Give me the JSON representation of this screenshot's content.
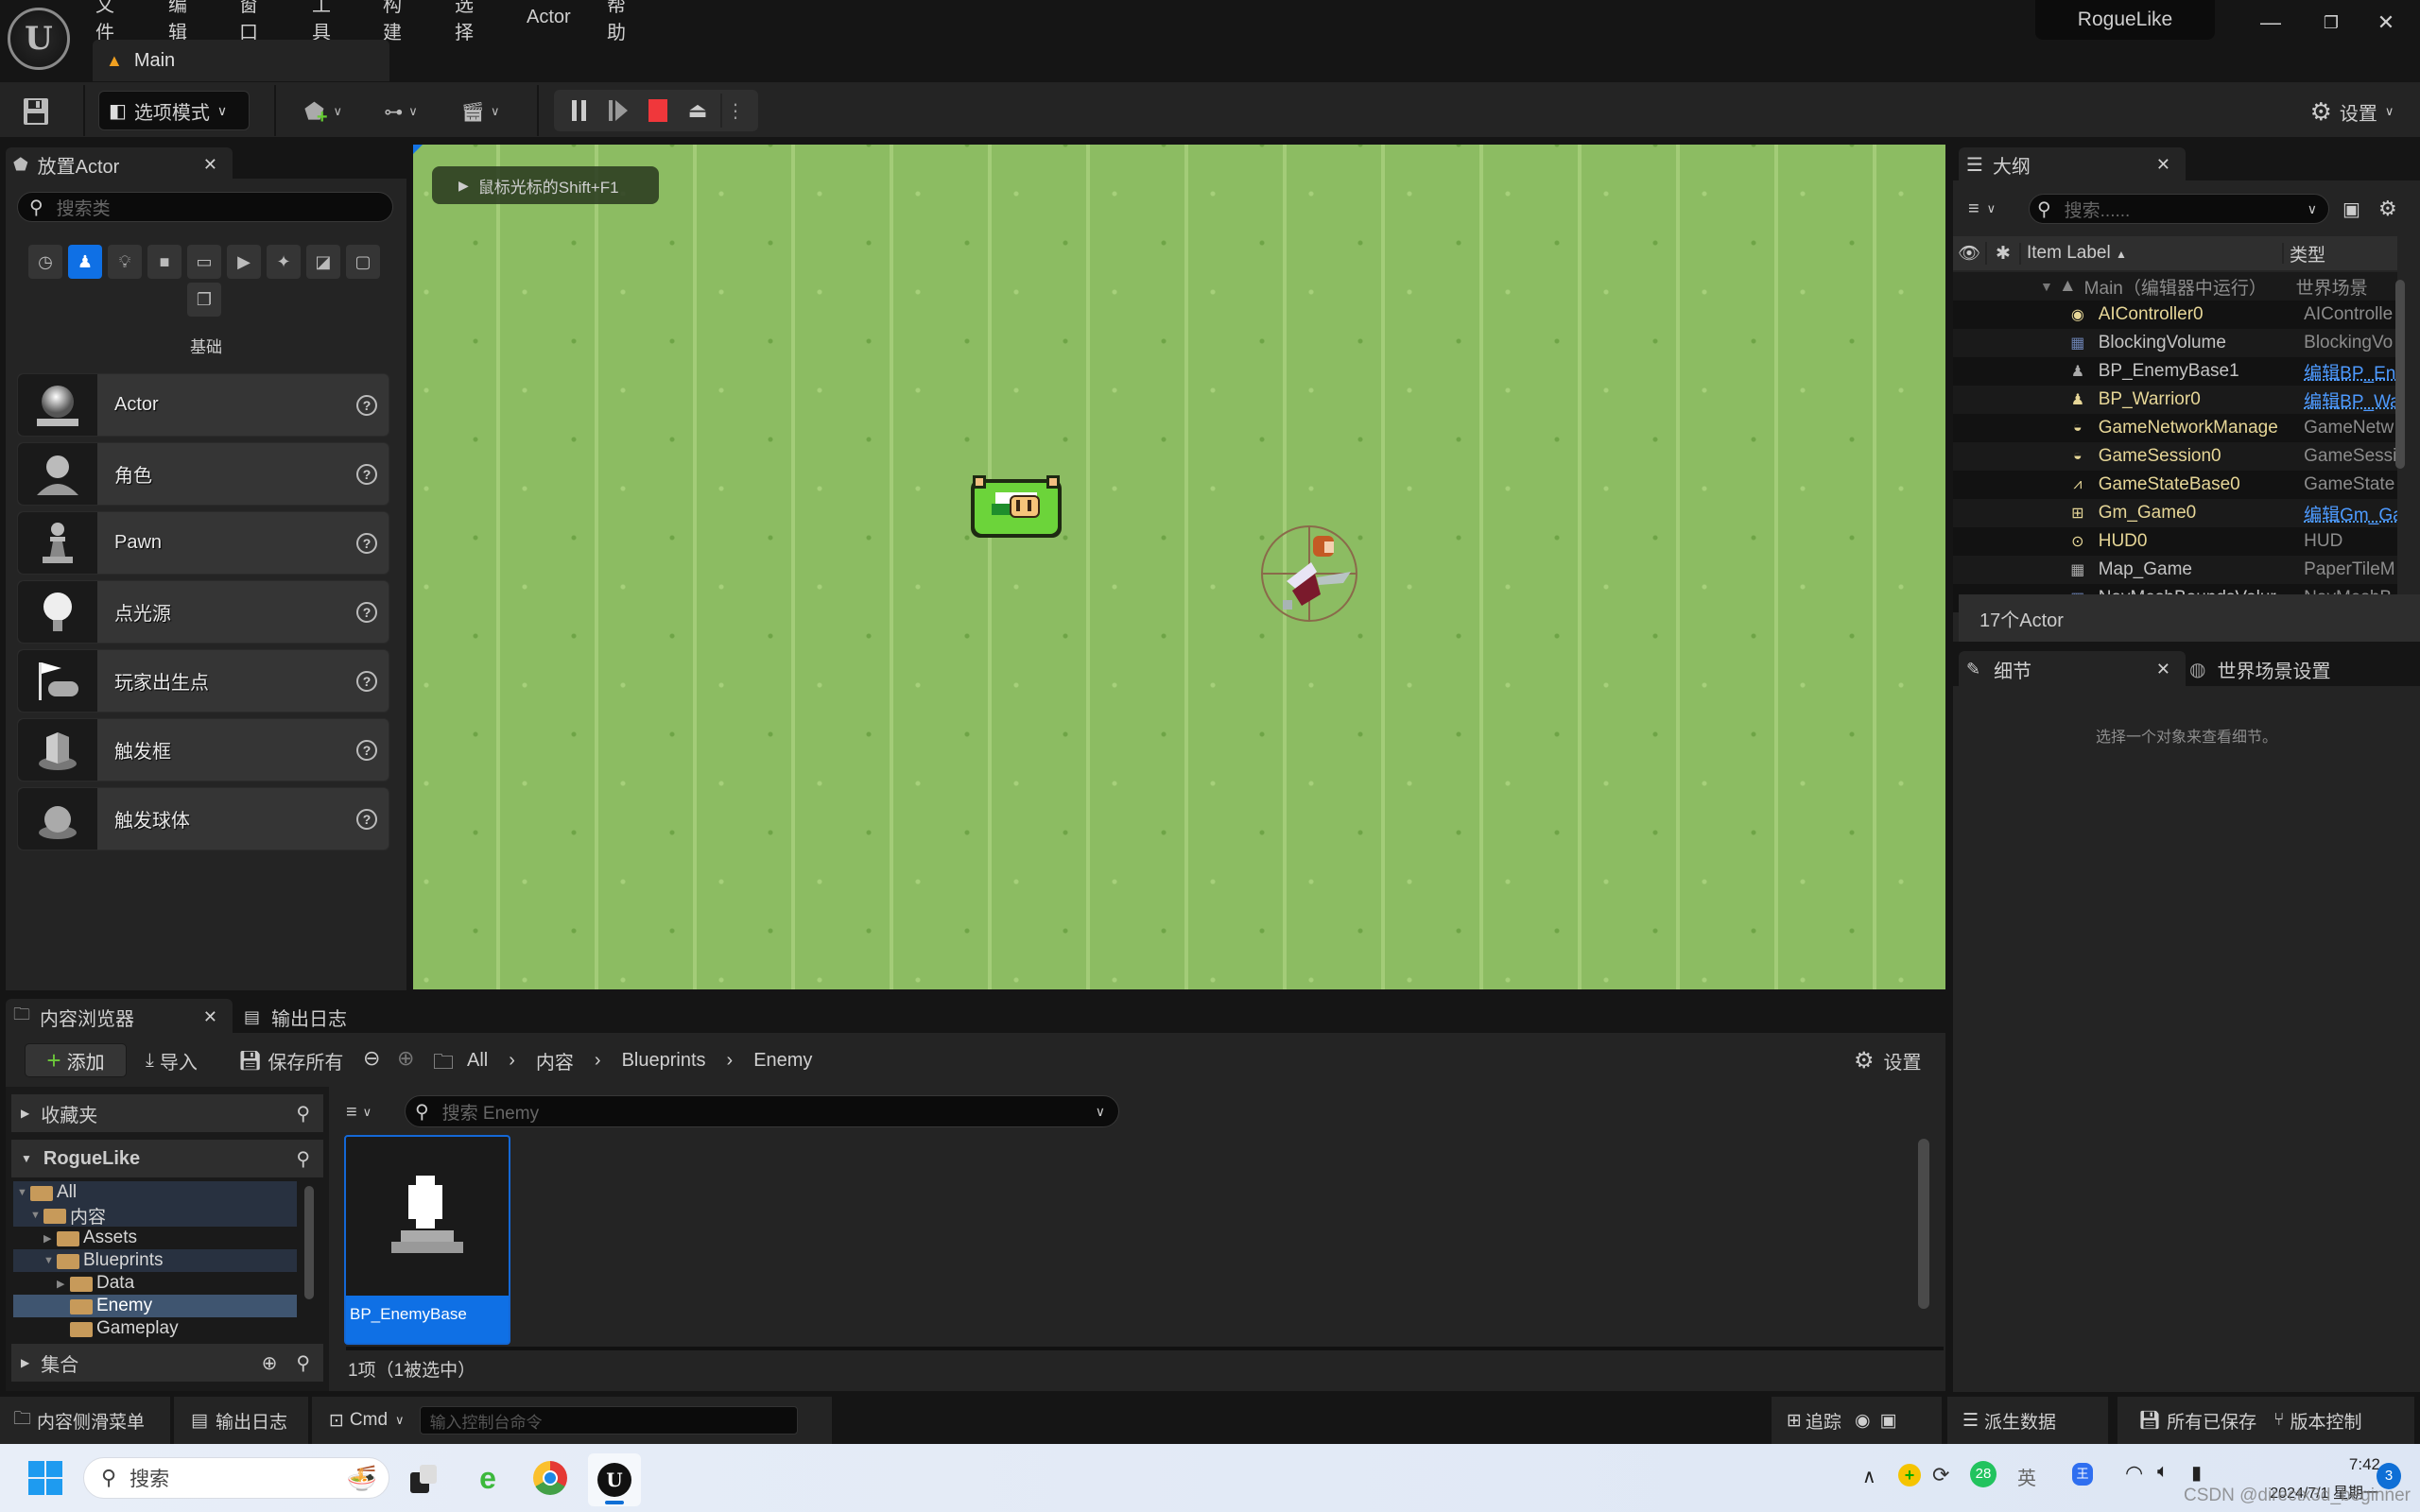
{
  "app": {
    "menu": [
      "文件",
      "编辑",
      "窗口",
      "工具",
      "构建",
      "选择",
      "Actor",
      "帮助"
    ],
    "level_tab": "Main",
    "project_name": "RogueLike",
    "window_controls": {
      "minimize": "—",
      "restore": "❐",
      "close": "✕"
    }
  },
  "toolbar": {
    "mode_label": "选项模式",
    "settings_label": "设置"
  },
  "place_actor": {
    "tab_label": "放置Actor",
    "search_placeholder": "搜索类",
    "category_label": "基础",
    "categories": [
      "recent",
      "basic",
      "lights",
      "shapes",
      "cinematic",
      "visual-effects",
      "volumes",
      "geometry",
      "all-classes",
      "extra"
    ],
    "items": [
      {
        "label": "Actor",
        "icon": "actor-sphere-icon"
      },
      {
        "label": "角色",
        "icon": "character-icon"
      },
      {
        "label": "Pawn",
        "icon": "pawn-icon"
      },
      {
        "label": "点光源",
        "icon": "point-light-icon"
      },
      {
        "label": "玩家出生点",
        "icon": "player-start-icon"
      },
      {
        "label": "触发框",
        "icon": "trigger-box-icon"
      },
      {
        "label": "触发球体",
        "icon": "trigger-sphere-icon"
      }
    ]
  },
  "viewport": {
    "hint": "鼠标光标的Shift+F1"
  },
  "outliner": {
    "tab_label": "大纲",
    "search_placeholder": "搜索......",
    "col_label": "Item Label",
    "col_type": "类型",
    "root": {
      "name": "Main（编辑器中运行）",
      "type": "世界场景"
    },
    "rows": [
      {
        "name": "AIController0",
        "type": "AIControlle",
        "link": false,
        "icon": "ai-controller-icon"
      },
      {
        "name": "BlockingVolume",
        "type": "BlockingVo",
        "link": false,
        "icon": "volume-icon",
        "dim": true
      },
      {
        "name": "BP_EnemyBase1",
        "type": "编辑BP_En",
        "link": true,
        "icon": "pawn-icon",
        "dim": true
      },
      {
        "name": "BP_Warrior0",
        "type": "编辑BP_Wa",
        "link": true,
        "icon": "pawn-icon"
      },
      {
        "name": "GameNetworkManage",
        "type": "GameNetw",
        "link": false,
        "icon": "actor-icon"
      },
      {
        "name": "GameSession0",
        "type": "GameSessi",
        "link": false,
        "icon": "actor-icon"
      },
      {
        "name": "GameStateBase0",
        "type": "GameState",
        "link": false,
        "icon": "game-state-icon"
      },
      {
        "name": "Gm_Game0",
        "type": "编辑Gm_Ga",
        "link": true,
        "icon": "game-mode-icon"
      },
      {
        "name": "HUD0",
        "type": "HUD",
        "link": false,
        "icon": "hud-icon"
      },
      {
        "name": "Map_Game",
        "type": "PaperTileM",
        "link": false,
        "icon": "tilemap-icon",
        "dim": true
      },
      {
        "name": "NavMeshBoundsVolur",
        "type": "NavMeshB",
        "link": false,
        "icon": "volume-icon",
        "dim": true
      }
    ],
    "count": "17个Actor"
  },
  "details": {
    "tab_label": "细节",
    "world_tab_label": "世界场景设置",
    "empty_message": "选择一个对象来查看细节。"
  },
  "content_browser": {
    "tab_label": "内容浏览器",
    "output_tab_label": "输出日志",
    "add_label": "添加",
    "import_label": "导入",
    "save_all_label": "保存所有",
    "breadcrumb": [
      "All",
      "内容",
      "Blueprints",
      "Enemy"
    ],
    "settings_label": "设置",
    "favorites_label": "收藏夹",
    "project_label": "RogueLike",
    "tree": [
      {
        "label": "All",
        "depth": 0,
        "expanded": true,
        "open": true
      },
      {
        "label": "内容",
        "depth": 1,
        "expanded": true,
        "open": true
      },
      {
        "label": "Assets",
        "depth": 2,
        "expanded": false,
        "hasChildren": true
      },
      {
        "label": "Blueprints",
        "depth": 2,
        "expanded": true,
        "open": true
      },
      {
        "label": "Data",
        "depth": 3,
        "expanded": false,
        "hasChildren": true
      },
      {
        "label": "Enemy",
        "depth": 3,
        "selected": true
      },
      {
        "label": "Gameplay",
        "depth": 3
      }
    ],
    "collections_label": "集合",
    "search_placeholder": "搜索 Enemy",
    "assets": [
      {
        "name": "BP_EnemyBase",
        "selected": true
      }
    ],
    "item_count": "1项（1被选中）"
  },
  "statusbar": {
    "content_drawer": "内容侧滑菜单",
    "output_log": "输出日志",
    "cmd": "Cmd",
    "console_placeholder": "输入控制台命令",
    "trace": "追踪",
    "derived_data": "派生数据",
    "all_saved": "所有已保存",
    "source_control": "版本控制"
  },
  "taskbar": {
    "search_placeholder": "搜索",
    "time": "7:42",
    "date": "2024/7/1 星期一",
    "notification_count": "3",
    "tray_badge": "28",
    "ime": "英",
    "watermark": "CSDN @directx3d_beginner"
  }
}
